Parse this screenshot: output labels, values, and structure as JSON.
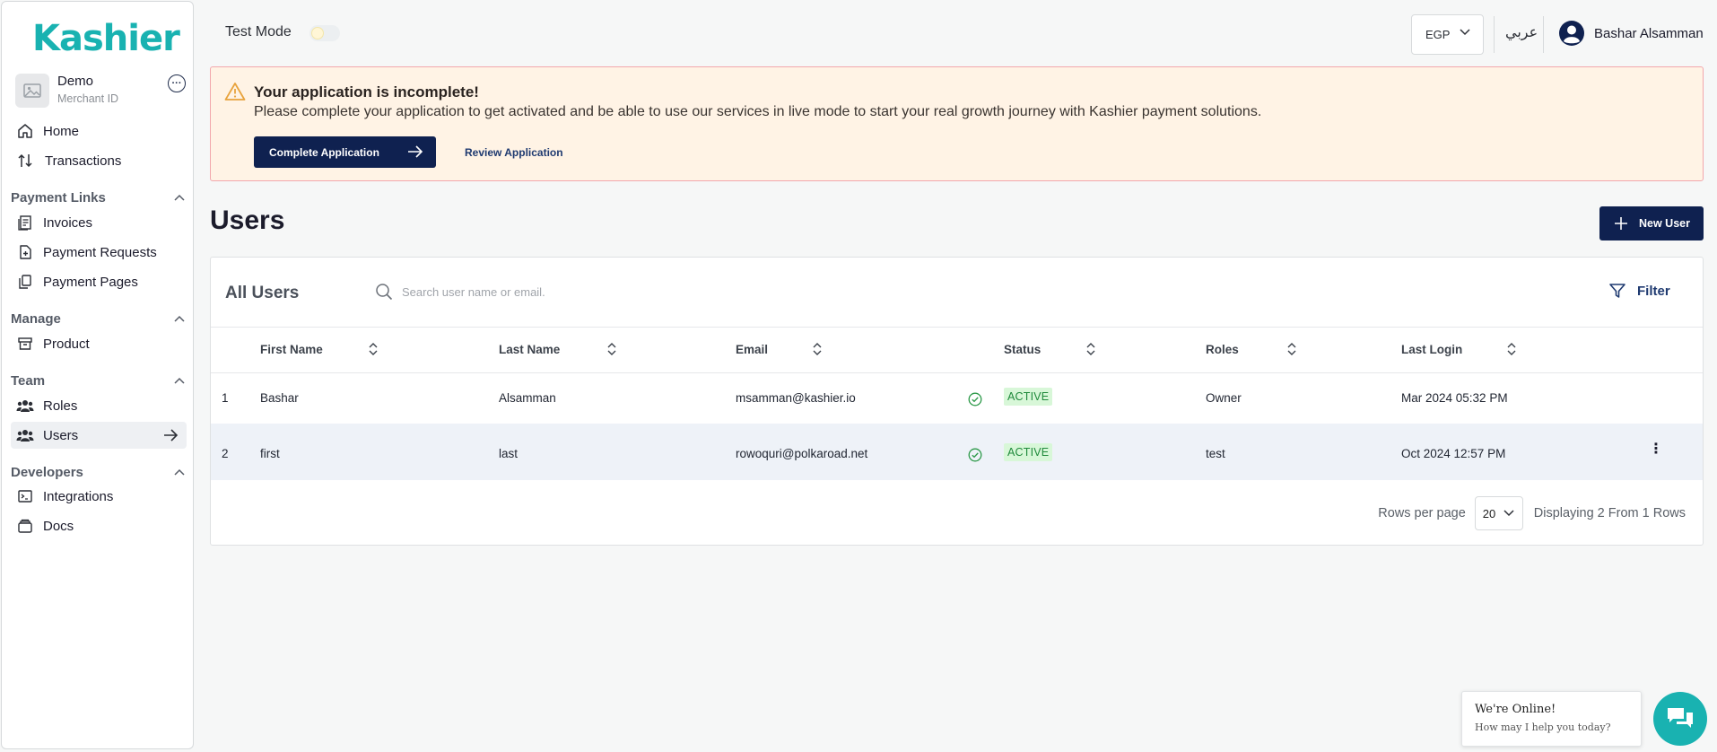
{
  "brand": {
    "logo_text": "Kashier",
    "accent": "#19b2b1",
    "primary": "#0f2150"
  },
  "merchant": {
    "name": "Demo",
    "id_label": "Merchant ID"
  },
  "sidebar": {
    "home": "Home",
    "transactions": "Transactions",
    "sections": {
      "payment_links": "Payment Links",
      "manage": "Manage",
      "team": "Team",
      "developers": "Developers"
    },
    "invoices": "Invoices",
    "payment_requests": "Payment Requests",
    "payment_pages": "Payment Pages",
    "product": "Product",
    "roles": "Roles",
    "users": "Users",
    "integrations": "Integrations",
    "docs": "Docs"
  },
  "topbar": {
    "test_mode_label": "Test Mode",
    "test_mode_on": false,
    "currency": "EGP",
    "language": "عربي",
    "user_name": "Bashar Alsamman"
  },
  "alert": {
    "title": "Your application is incomplete!",
    "message": "Please complete your application to get activated and be able to use our services in live mode to start your real growth journey with Kashier payment solutions.",
    "primary_button": "Complete Application",
    "secondary_button": "Review Application"
  },
  "page": {
    "title": "Users",
    "new_button": "New User"
  },
  "card": {
    "heading": "All Users",
    "search_placeholder": "Search user name or email.",
    "filter_label": "Filter"
  },
  "table": {
    "columns": [
      "First Name",
      "Last Name",
      "Email",
      "Status",
      "Roles",
      "Last Login"
    ],
    "rows": [
      {
        "index": "1",
        "first": "Bashar",
        "last": "Alsamman",
        "email": "msamman@kashier.io",
        "status": "ACTIVE",
        "role": "Owner",
        "last_login": "Mar 2024 05:32 PM"
      },
      {
        "index": "2",
        "first": "first",
        "last": "last",
        "email": "rowoquri@polkaroad.net",
        "status": "ACTIVE",
        "role": "test",
        "last_login": "Oct 2024 12:57 PM"
      }
    ]
  },
  "pagination": {
    "rows_per_page_label": "Rows per page",
    "rows_per_page": "20",
    "summary": "Displaying 2 From 1 Rows"
  },
  "chat": {
    "line1": "We're Online!",
    "line2": "How may I help you today?"
  }
}
